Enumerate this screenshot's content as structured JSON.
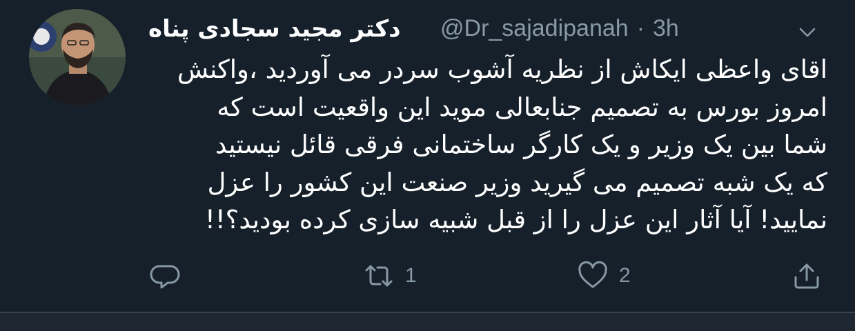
{
  "tweet": {
    "author_name": "دکتر مجید سجادی پناه",
    "handle": "@Dr_sajadipanah",
    "separator": "·",
    "time": "3h",
    "lines": [
      "اقای واعظی ایکاش از نظریه آشوب سردر می آوردید ،واکنش",
      "امروز بورس به تصمیم جنابعالی موید این واقعیت  است  که",
      "شما   بین  یک وزیر و یک کارگر ساختمانی فرقی قائل نیستید",
      "که یک شبه  تصمیم می گیرید وزیر صنعت این کشور را عزل",
      "نمایید! آیا آثار این عزل را از قبل شبیه سازی کرده بودید؟!!"
    ]
  },
  "actions": {
    "reply_icon": "reply-icon",
    "retweet_icon": "retweet-icon",
    "retweet_count": "1",
    "like_icon": "heart-icon",
    "like_count": "2",
    "share_icon": "share-icon"
  },
  "colors": {
    "background": "#15202b",
    "text": "#ffffff",
    "secondary": "#8899a6",
    "divider": "#38444d"
  }
}
